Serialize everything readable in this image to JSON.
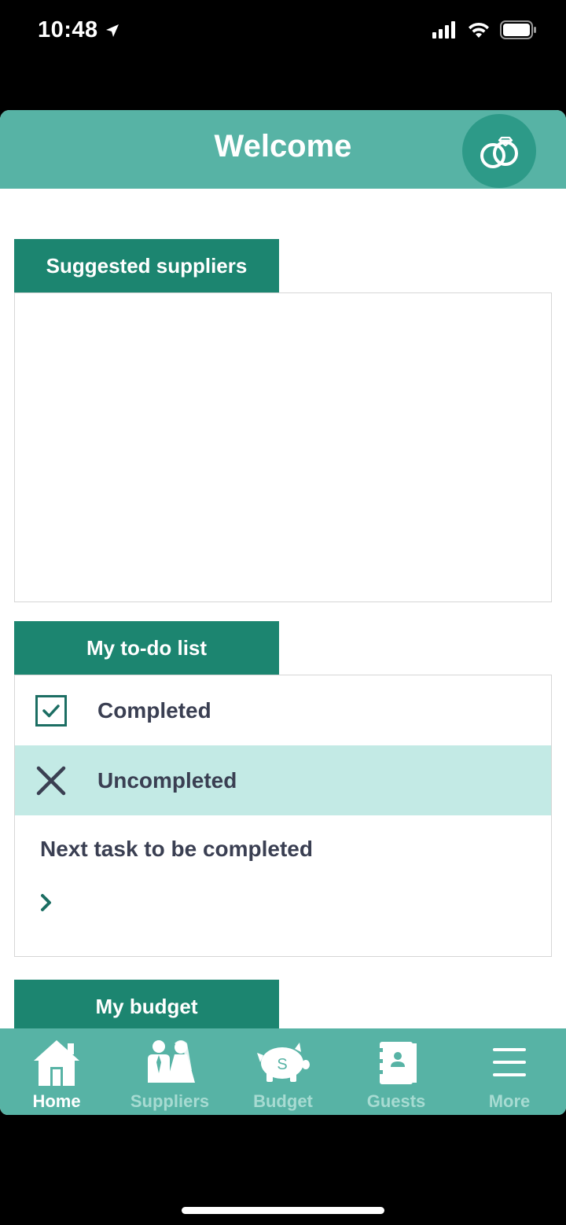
{
  "status": {
    "time": "10:48"
  },
  "header": {
    "title": "Welcome",
    "logo_icon": "wedding-rings-icon"
  },
  "suggested": {
    "title": "Suggested suppliers"
  },
  "todo": {
    "title": "My to-do list",
    "completed_label": "Completed",
    "uncompleted_label": "Uncompleted",
    "next_task_label": "Next task to be completed"
  },
  "budget": {
    "title": "My budget"
  },
  "tabbar": {
    "items": [
      {
        "label": "Home",
        "icon": "home-icon",
        "active": true
      },
      {
        "label": "Suppliers",
        "icon": "couple-icon",
        "active": false
      },
      {
        "label": "Budget",
        "icon": "piggy-bank-icon",
        "active": false
      },
      {
        "label": "Guests",
        "icon": "address-book-icon",
        "active": false
      },
      {
        "label": "More",
        "icon": "menu-icon",
        "active": false
      }
    ]
  },
  "colors": {
    "header": "#57b3a5",
    "tab_dark": "#1c8570",
    "highlight": "#c3eae5",
    "text": "#3a3f52"
  }
}
